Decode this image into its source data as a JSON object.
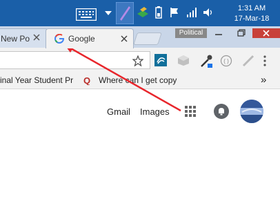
{
  "taskbar": {
    "time": "1:31 AM",
    "date": "17-Mar-18",
    "icons": [
      "keyboard-icon",
      "chevron-up-icon",
      "pen-icon",
      "network-share-icon",
      "battery-icon",
      "flag-icon",
      "signal-icon",
      "volume-icon"
    ]
  },
  "browser": {
    "tabs": [
      {
        "label": "New Po"
      },
      {
        "label": "Google",
        "icon": "google-g-icon",
        "active": true
      }
    ],
    "profile_label": "Political",
    "bookmarks": [
      {
        "label": "inal Year Student Pr"
      },
      {
        "label": "Where can I get copy",
        "icon": "quora-icon"
      }
    ],
    "more_bookmarks": "»"
  },
  "google": {
    "gmail": "Gmail",
    "images": "Images"
  }
}
